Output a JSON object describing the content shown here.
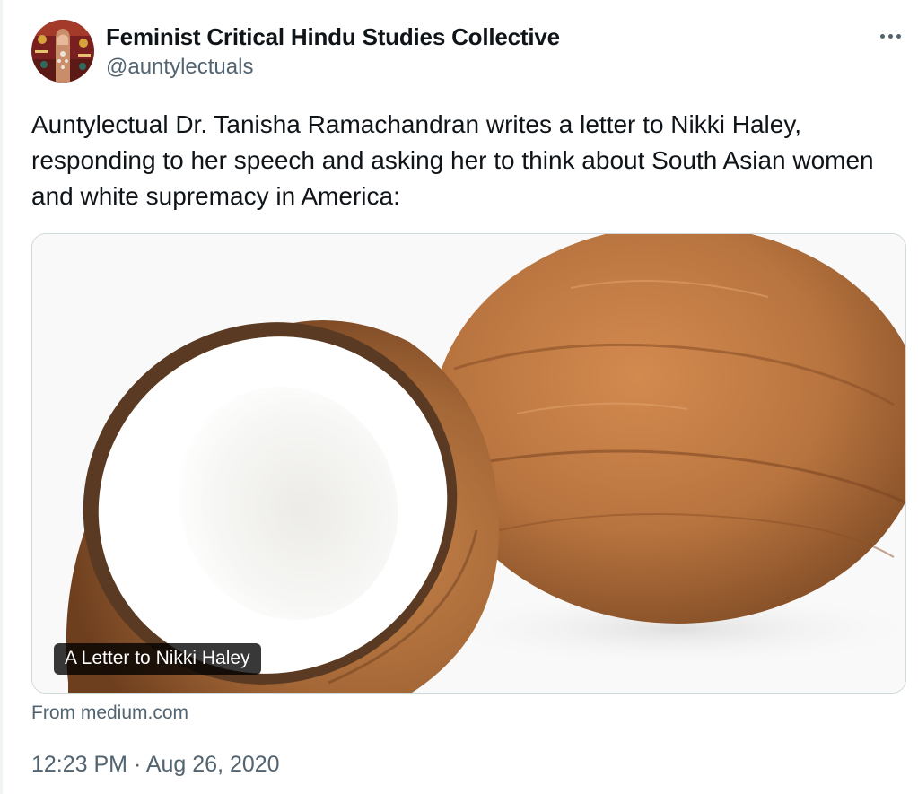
{
  "tweet": {
    "author": {
      "display_name": "Feminist Critical Hindu Studies Collective",
      "handle": "@auntylectuals",
      "avatar_icon": "avatar-image"
    },
    "more_icon": "more-horizontal-icon",
    "text": "Auntylectual Dr. Tanisha Ramachandran writes a letter to Nikki Haley, responding to her speech and asking her to think about South Asian women and white supremacy in America:",
    "card": {
      "title": "A Letter to Nikki Haley",
      "source": "From medium.com",
      "image_subject": "coconut-image"
    },
    "timestamp": "12:23 PM · Aug 26, 2020"
  },
  "colors": {
    "text_primary": "#0f1419",
    "text_secondary": "#536471",
    "border": "#cfd9de",
    "coconut_husk": "#b8743f",
    "coconut_flesh": "#ffffff"
  }
}
